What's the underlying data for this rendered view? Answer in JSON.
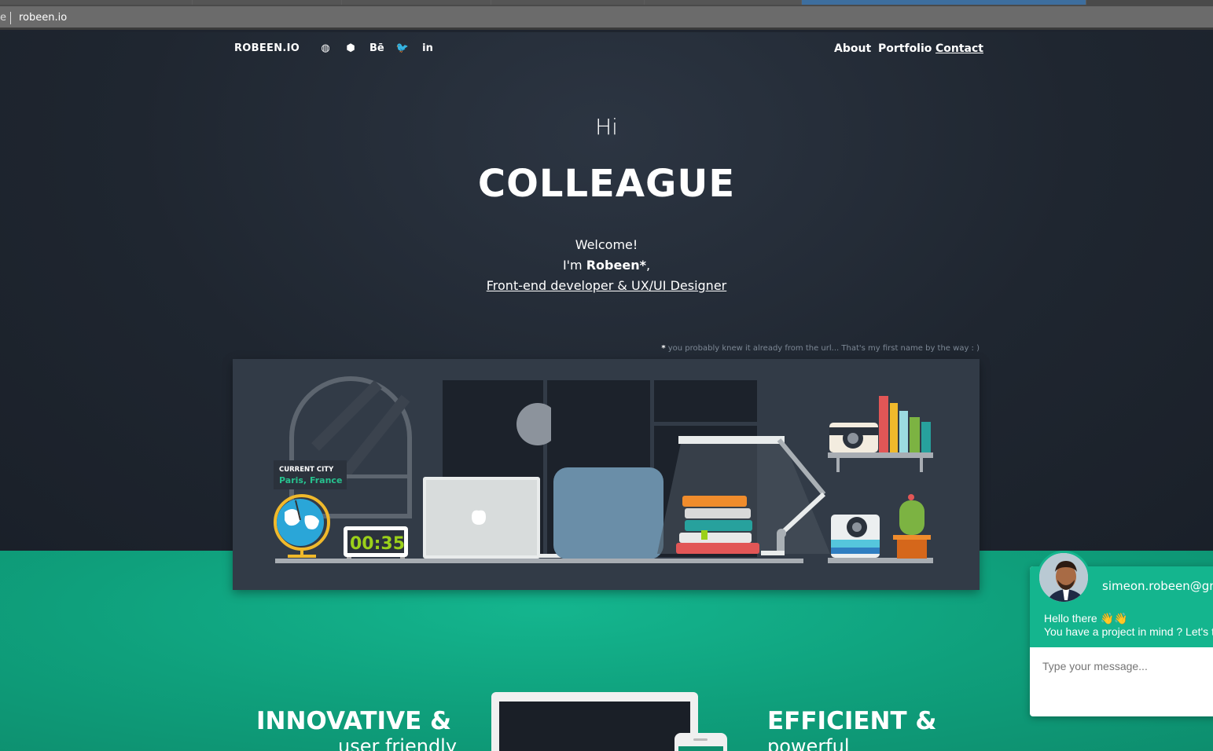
{
  "browser": {
    "url": "robeen.io",
    "partial_left": "e"
  },
  "nav": {
    "brand": "ROBEEN.IO",
    "social": [
      {
        "icon": "github-icon",
        "glyph": "◍"
      },
      {
        "icon": "codepen-icon",
        "glyph": "⬢"
      },
      {
        "icon": "behance-icon",
        "glyph": "Bē"
      },
      {
        "icon": "twitter-icon",
        "glyph": "🐦"
      },
      {
        "icon": "linkedin-icon",
        "glyph": "in"
      }
    ],
    "links": [
      "About",
      "Portfolio",
      "Contact"
    ],
    "active_link": "Contact"
  },
  "hero": {
    "greeting": "Hi",
    "title": "COLLEAGUE",
    "welcome": "Welcome!",
    "im_prefix": "I'm ",
    "name": "Robeen*",
    "name_suffix": ",",
    "role": "Front-end developer & UX/UI Designer",
    "footnote_star": "*",
    "footnote": " you probably knew it already from the url... That's my first name by the way : )"
  },
  "illustration": {
    "city_label": "CURRENT CITY",
    "city": "Paris, France",
    "clock": "00:35"
  },
  "features": {
    "left_title": "INNOVATIVE &",
    "left_sub": "user friendly",
    "right_title": "EFFICIENT &",
    "right_sub": "powerful"
  },
  "chat": {
    "email": "simeon.robeen@gmail.com",
    "line1": "Hello there 👋👋",
    "line2": "You have a project in mind ? Let's talk!",
    "placeholder": "Type your message..."
  },
  "colors": {
    "hero_bg": "#1f2630",
    "accent_green": "#14b58e",
    "scene_bg": "#323b47"
  }
}
